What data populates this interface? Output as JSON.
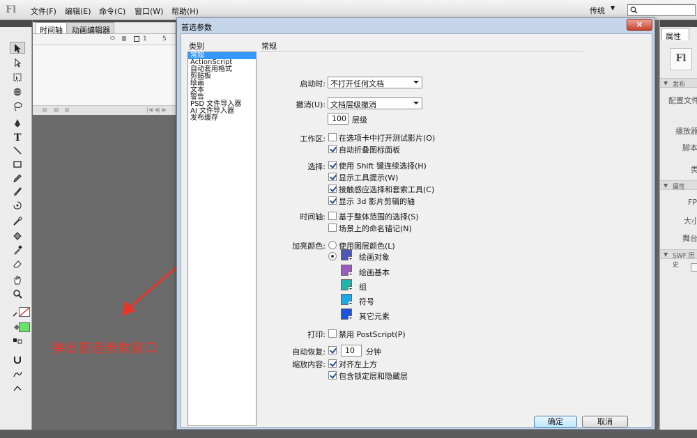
{
  "app": {
    "logo": "Fl",
    "menu": [
      "文件(F)",
      "编辑(E)",
      "命令(C)",
      "窗口(W)",
      "帮助(H)"
    ],
    "workspace": "传统",
    "search_placeholder": ""
  },
  "timeline": {
    "tabs": [
      "时间轴",
      "动画编辑器"
    ],
    "ruler_marks": [
      "1",
      "5"
    ]
  },
  "annotation": {
    "text": "弹出首选参数窗口",
    "color": "#e8352a"
  },
  "right_panel": {
    "tab": "属性",
    "logo": "Fl",
    "sections": [
      "发布",
      "属性",
      "SWF 历史"
    ],
    "labels": [
      "配置文件",
      "播放器",
      "脚本",
      "类",
      "FPS",
      "大小",
      "舞台"
    ]
  },
  "dialog": {
    "title": "首选参数",
    "close": "×",
    "category_header": "类别",
    "categories": [
      "常规",
      "ActionScript",
      "自动套用格式",
      "剪贴板",
      "绘画",
      "文本",
      "警告",
      "PSD 文件导入器",
      "AI 文件导入器",
      "发布缓存"
    ],
    "selected_category": 0,
    "pane_title": "常规",
    "startup": {
      "label": "启动时:",
      "value": "不打开任何文档"
    },
    "undo": {
      "label": "撤消(U):",
      "value": "文档层级撤消",
      "levels": "100",
      "levels_unit": "层级"
    },
    "workspace": {
      "label": "工作区:",
      "options": [
        {
          "text": "在选项卡中打开测试影片(O)",
          "checked": false
        },
        {
          "text": "自动折叠图标面板",
          "checked": true
        }
      ]
    },
    "selection": {
      "label": "选择:",
      "options": [
        {
          "text": "使用 Shift 键连续选择(H)",
          "checked": true
        },
        {
          "text": "显示工具提示(W)",
          "checked": true
        },
        {
          "text": "接触感应选择和套索工具(C)",
          "checked": true
        },
        {
          "text": "显示 3d 影片剪辑的轴",
          "checked": true
        }
      ]
    },
    "timeline_opts": {
      "label": "时间轴:",
      "options": [
        {
          "text": "基于整体范围的选择(S)",
          "checked": false
        },
        {
          "text": "场景上的命名锚记(N)",
          "checked": false
        }
      ]
    },
    "highlight": {
      "label": "加亮颜色:",
      "radio_layer": "使用图层颜色(L)",
      "radio_custom_selected": true,
      "colors": [
        {
          "name": "绘画对象",
          "hex": "#4b56b6"
        },
        {
          "name": "绘画基本",
          "hex": "#9a5bc1"
        },
        {
          "name": "组",
          "hex": "#22b5ad"
        },
        {
          "name": "符号",
          "hex": "#1aa8e8"
        },
        {
          "name": "其它元素",
          "hex": "#1c54e0"
        }
      ]
    },
    "print": {
      "label": "打印:",
      "text": "禁用 PostScript(P)",
      "checked": false
    },
    "autorecover": {
      "label": "自动恢复:",
      "checked": true,
      "value": "10",
      "unit": "分钟"
    },
    "scale": {
      "label": "缩放内容:",
      "options": [
        {
          "text": "对齐左上方",
          "checked": true
        },
        {
          "text": "包含锁定层和隐藏层",
          "checked": true
        }
      ]
    },
    "ok": "确定",
    "cancel": "取消"
  }
}
